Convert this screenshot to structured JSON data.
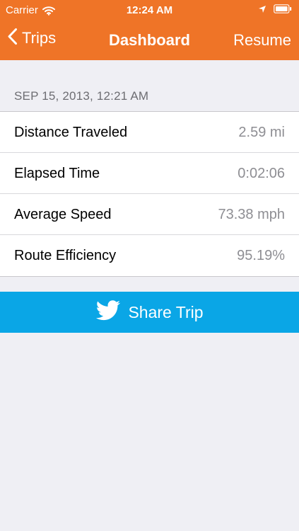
{
  "status_bar": {
    "carrier": "Carrier",
    "time": "12:24 AM",
    "icons": [
      "wifi-icon",
      "location-icon",
      "battery-icon"
    ]
  },
  "nav": {
    "back_label": "Trips",
    "title": "Dashboard",
    "action_label": "Resume"
  },
  "trip": {
    "date": "SEP 15, 2013, 12:21 AM",
    "stats": [
      {
        "label": "Distance Traveled",
        "value": "2.59 mi"
      },
      {
        "label": "Elapsed Time",
        "value": "0:02:06"
      },
      {
        "label": "Average Speed",
        "value": "73.38 mph"
      },
      {
        "label": "Route Efficiency",
        "value": "95.19%"
      }
    ]
  },
  "share": {
    "label": "Share Trip",
    "icon": "twitter-bird-icon"
  },
  "colors": {
    "nav_background": "#ef7427",
    "share_background": "#0aa6e6",
    "page_background": "#efeff4",
    "secondary_text": "#8e8e93",
    "section_text": "#6d6d72"
  }
}
